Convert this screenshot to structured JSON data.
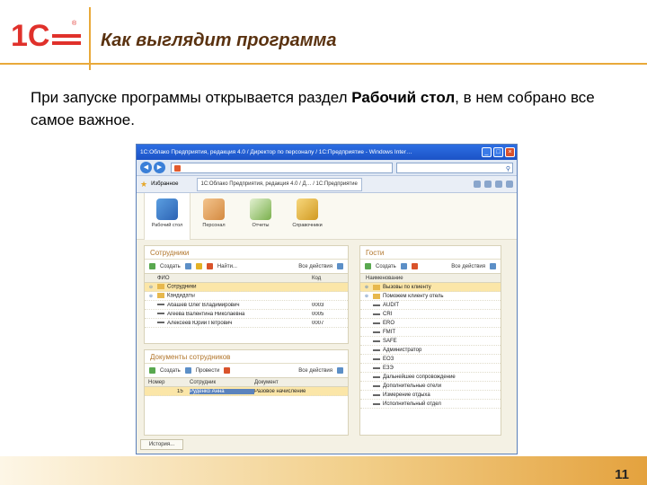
{
  "slide": {
    "title": "Как выглядит программа",
    "intro_before": "При запуске программы открывается раздел ",
    "intro_bold": "Рабочий стол",
    "intro_after": ", в нем собрано все самое важное.",
    "page_number": "11",
    "logo_text": "1С",
    "accent_color": "#e9a93a",
    "title_color": "#5a3210"
  },
  "window": {
    "title": "1С:Облако Предприятия, редакция 4.0 / Директор по персоналу / 1С:Предприятие - Windows Inter…",
    "tab_label": "1С:Облако Предприятия, редакция 4.0 / Д… / 1С:Предприятие",
    "favorites_label": "Избранное",
    "icons": [
      "back-icon",
      "forward-icon",
      "refresh-icon",
      "stop-icon",
      "search-icon",
      "star-icon"
    ]
  },
  "app": {
    "nav": [
      {
        "label": "Рабочий стол",
        "icon": "desktop-icon"
      },
      {
        "label": "Персонал",
        "icon": "people-icon"
      },
      {
        "label": "Отчеты",
        "icon": "documents-icon"
      },
      {
        "label": "Справочники",
        "icon": "rooms-icon"
      }
    ],
    "employees": {
      "title": "Сотрудники",
      "toolbar": [
        "Создать",
        "Найти...",
        "Все действия"
      ],
      "columns": [
        "ФИО",
        "Код"
      ],
      "rows": [
        {
          "name": "Сотрудники",
          "code": "",
          "type": "folder",
          "selected": true
        },
        {
          "name": "Кандидаты",
          "code": "",
          "type": "folder",
          "selected": false
        },
        {
          "name": "Абашев Олег Владимирович",
          "code": "0003",
          "type": "item",
          "selected": false
        },
        {
          "name": "Агеева Валентина Николаевна",
          "code": "0005",
          "type": "item",
          "selected": false
        },
        {
          "name": "Алексеев Юрий Петрович",
          "code": "0007",
          "type": "item",
          "selected": false
        }
      ]
    },
    "documents": {
      "title": "Документы сотрудников",
      "toolbar": [
        "Создать",
        "Провести",
        "Все действия"
      ],
      "columns": [
        "Номер",
        "Сотрудник",
        "Документ"
      ],
      "rows": [
        {
          "number": "15",
          "employee": "Руденко Анна",
          "doc": "Разовое начисление"
        }
      ]
    },
    "guests": {
      "title": "Гости",
      "toolbar": [
        "Создать",
        "Все действия"
      ],
      "columns": [
        "Наименование"
      ],
      "rows": [
        {
          "name": "Вызовы по клиенту",
          "type": "folder",
          "selected": true
        },
        {
          "name": "Поможем клиенту отель",
          "type": "folder",
          "selected": false
        },
        {
          "name": "AUDIT",
          "type": "item",
          "selected": false
        },
        {
          "name": "CRI",
          "type": "item",
          "selected": false
        },
        {
          "name": "ERO",
          "type": "item",
          "selected": false
        },
        {
          "name": "FMIT",
          "type": "item",
          "selected": false
        },
        {
          "name": "SAFE",
          "type": "item",
          "selected": false
        },
        {
          "name": "Администратор",
          "type": "item",
          "selected": false
        },
        {
          "name": "ЕОЗ",
          "type": "item",
          "selected": false
        },
        {
          "name": "ЕЗЭ",
          "type": "item",
          "selected": false
        },
        {
          "name": "Дальнейшее сопровождение",
          "type": "item",
          "selected": false
        },
        {
          "name": "Дополнительные отели",
          "type": "item",
          "selected": false
        },
        {
          "name": "Измерение отдыха",
          "type": "item",
          "selected": false
        },
        {
          "name": "Исполнительный отдел",
          "type": "item",
          "selected": false
        }
      ]
    },
    "status_label": "История..."
  }
}
